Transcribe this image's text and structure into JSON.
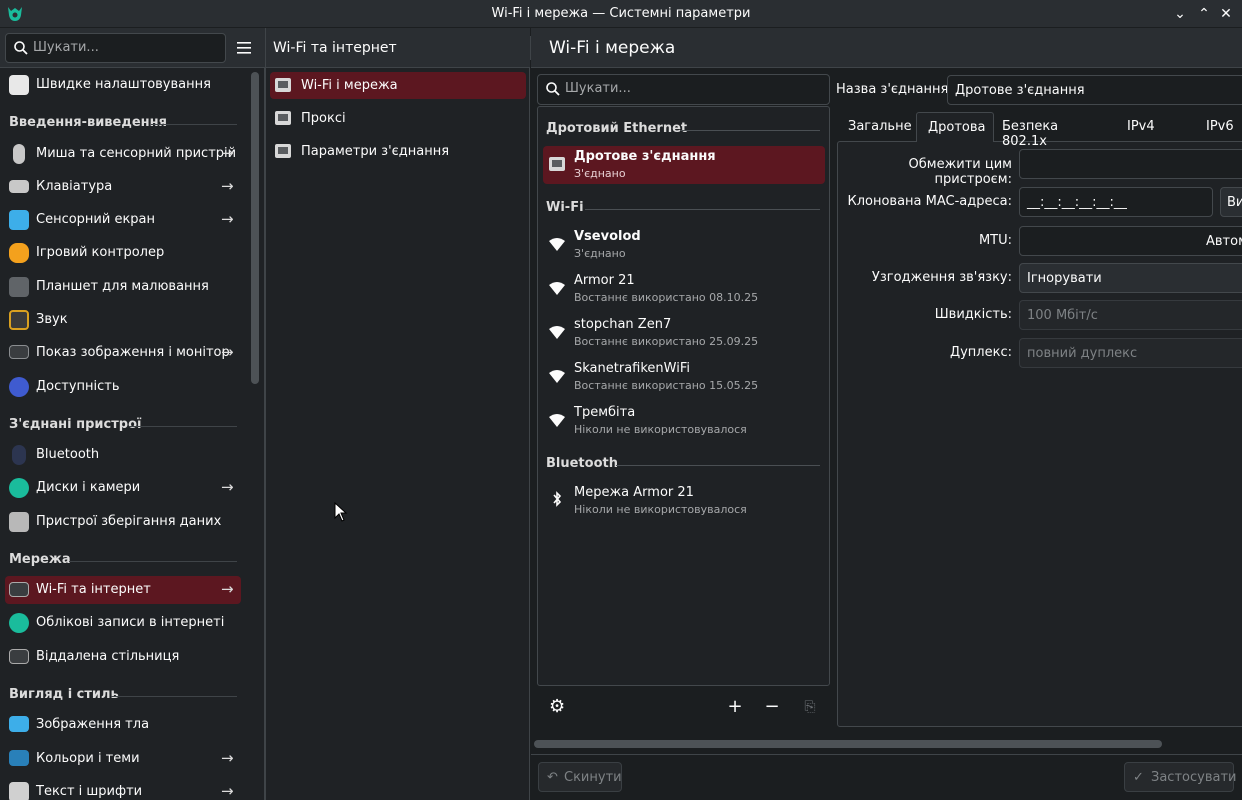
{
  "window": {
    "title": "Wi-Fi і мережа — Системні параметри"
  },
  "sidebar": {
    "search_placeholder": "Шукати...",
    "items": [
      {
        "label": "Швидке налаштовування",
        "arrow": false
      },
      {
        "section": "Введення-виведення"
      },
      {
        "label": "Миша та сенсорний пристрій",
        "arrow": true
      },
      {
        "label": "Клавіатура",
        "arrow": true
      },
      {
        "label": "Сенсорний екран",
        "arrow": true
      },
      {
        "label": "Ігровий контролер",
        "arrow": false
      },
      {
        "label": "Планшет для малювання",
        "arrow": false
      },
      {
        "label": "Звук",
        "arrow": false
      },
      {
        "label": "Показ зображення і монітор",
        "arrow": true
      },
      {
        "label": "Доступність",
        "arrow": false
      },
      {
        "section": "З'єднані пристрої"
      },
      {
        "label": "Bluetooth",
        "arrow": false
      },
      {
        "label": "Диски і камери",
        "arrow": true
      },
      {
        "label": "Пристрої зберігання даних",
        "arrow": false
      },
      {
        "section": "Мережа"
      },
      {
        "label": "Wi-Fi та інтернет",
        "arrow": true,
        "active": true
      },
      {
        "label": "Облікові записи в інтернеті",
        "arrow": false
      },
      {
        "label": "Віддалена стільниця",
        "arrow": false
      },
      {
        "section": "Вигляд і стиль"
      },
      {
        "label": "Зображення тла",
        "arrow": false
      },
      {
        "label": "Кольори і теми",
        "arrow": true
      },
      {
        "label": "Текст і шрифти",
        "arrow": true
      }
    ]
  },
  "middle": {
    "header": "Wi-Fi та інтернет",
    "items": [
      "Wi-Fi і мережа",
      "Проксі",
      "Параметри з'єднання"
    ]
  },
  "main": {
    "header": "Wi-Fi і мережа",
    "search_placeholder": "Шукати...",
    "groups": [
      {
        "title": "Дротовий Ethernet",
        "connections": [
          {
            "name": "Дротове з'єднання",
            "status": "З'єднано",
            "icon": "ethernet-icon",
            "active": true
          }
        ]
      },
      {
        "title": "Wi-Fi",
        "connections": [
          {
            "name": "Vsevolod",
            "status": "З'єднано",
            "icon": "wifi-icon",
            "bold": true
          },
          {
            "name": "Armor 21",
            "status": "Востаннє використано 08.10.25",
            "icon": "wifi-icon"
          },
          {
            "name": "stopchan Zen7",
            "status": "Востаннє використано 25.09.25",
            "icon": "wifi-icon"
          },
          {
            "name": "SkanetrafikenWiFi",
            "status": "Востаннє використано 15.05.25",
            "icon": "wifi-icon"
          },
          {
            "name": "Трембіта",
            "status": "Ніколи не використовувалося",
            "icon": "wifi-icon"
          }
        ]
      },
      {
        "title": "Bluetooth",
        "connections": [
          {
            "name": "Мережа Armor 21",
            "status": "Ніколи не використовувалося",
            "icon": "bluetooth-icon"
          }
        ]
      }
    ],
    "details": {
      "name_label": "Назва з'єднання:",
      "name_value": "Дротове з'єднання",
      "tabs": [
        "Загальне",
        "Дротова",
        "Безпека 802.1x",
        "IPv4",
        "IPv6"
      ],
      "selected_tab": "Дротова",
      "restrict_label": "Обмежити цим пристроєм:",
      "restrict_value": "",
      "mac_label": "Клонована MAC-адреса:",
      "mac_value": "__:__:__:__:__:__",
      "mac_button": "Ви",
      "mtu_label": "MTU:",
      "mtu_value": "Автом",
      "negotiation_label": "Узгодження зв'язку:",
      "negotiation_value": "Ігнорувати",
      "speed_label": "Швидкість:",
      "speed_value": "100 Мбіт/с",
      "duplex_label": "Дуплекс:",
      "duplex_value": "повний дуплекс"
    },
    "reset_button": "Скинути",
    "apply_button": "Застосувати"
  },
  "colors": {
    "accent_bg": "#5c1720",
    "background": "#1b1e20",
    "panel": "#1f2225"
  }
}
